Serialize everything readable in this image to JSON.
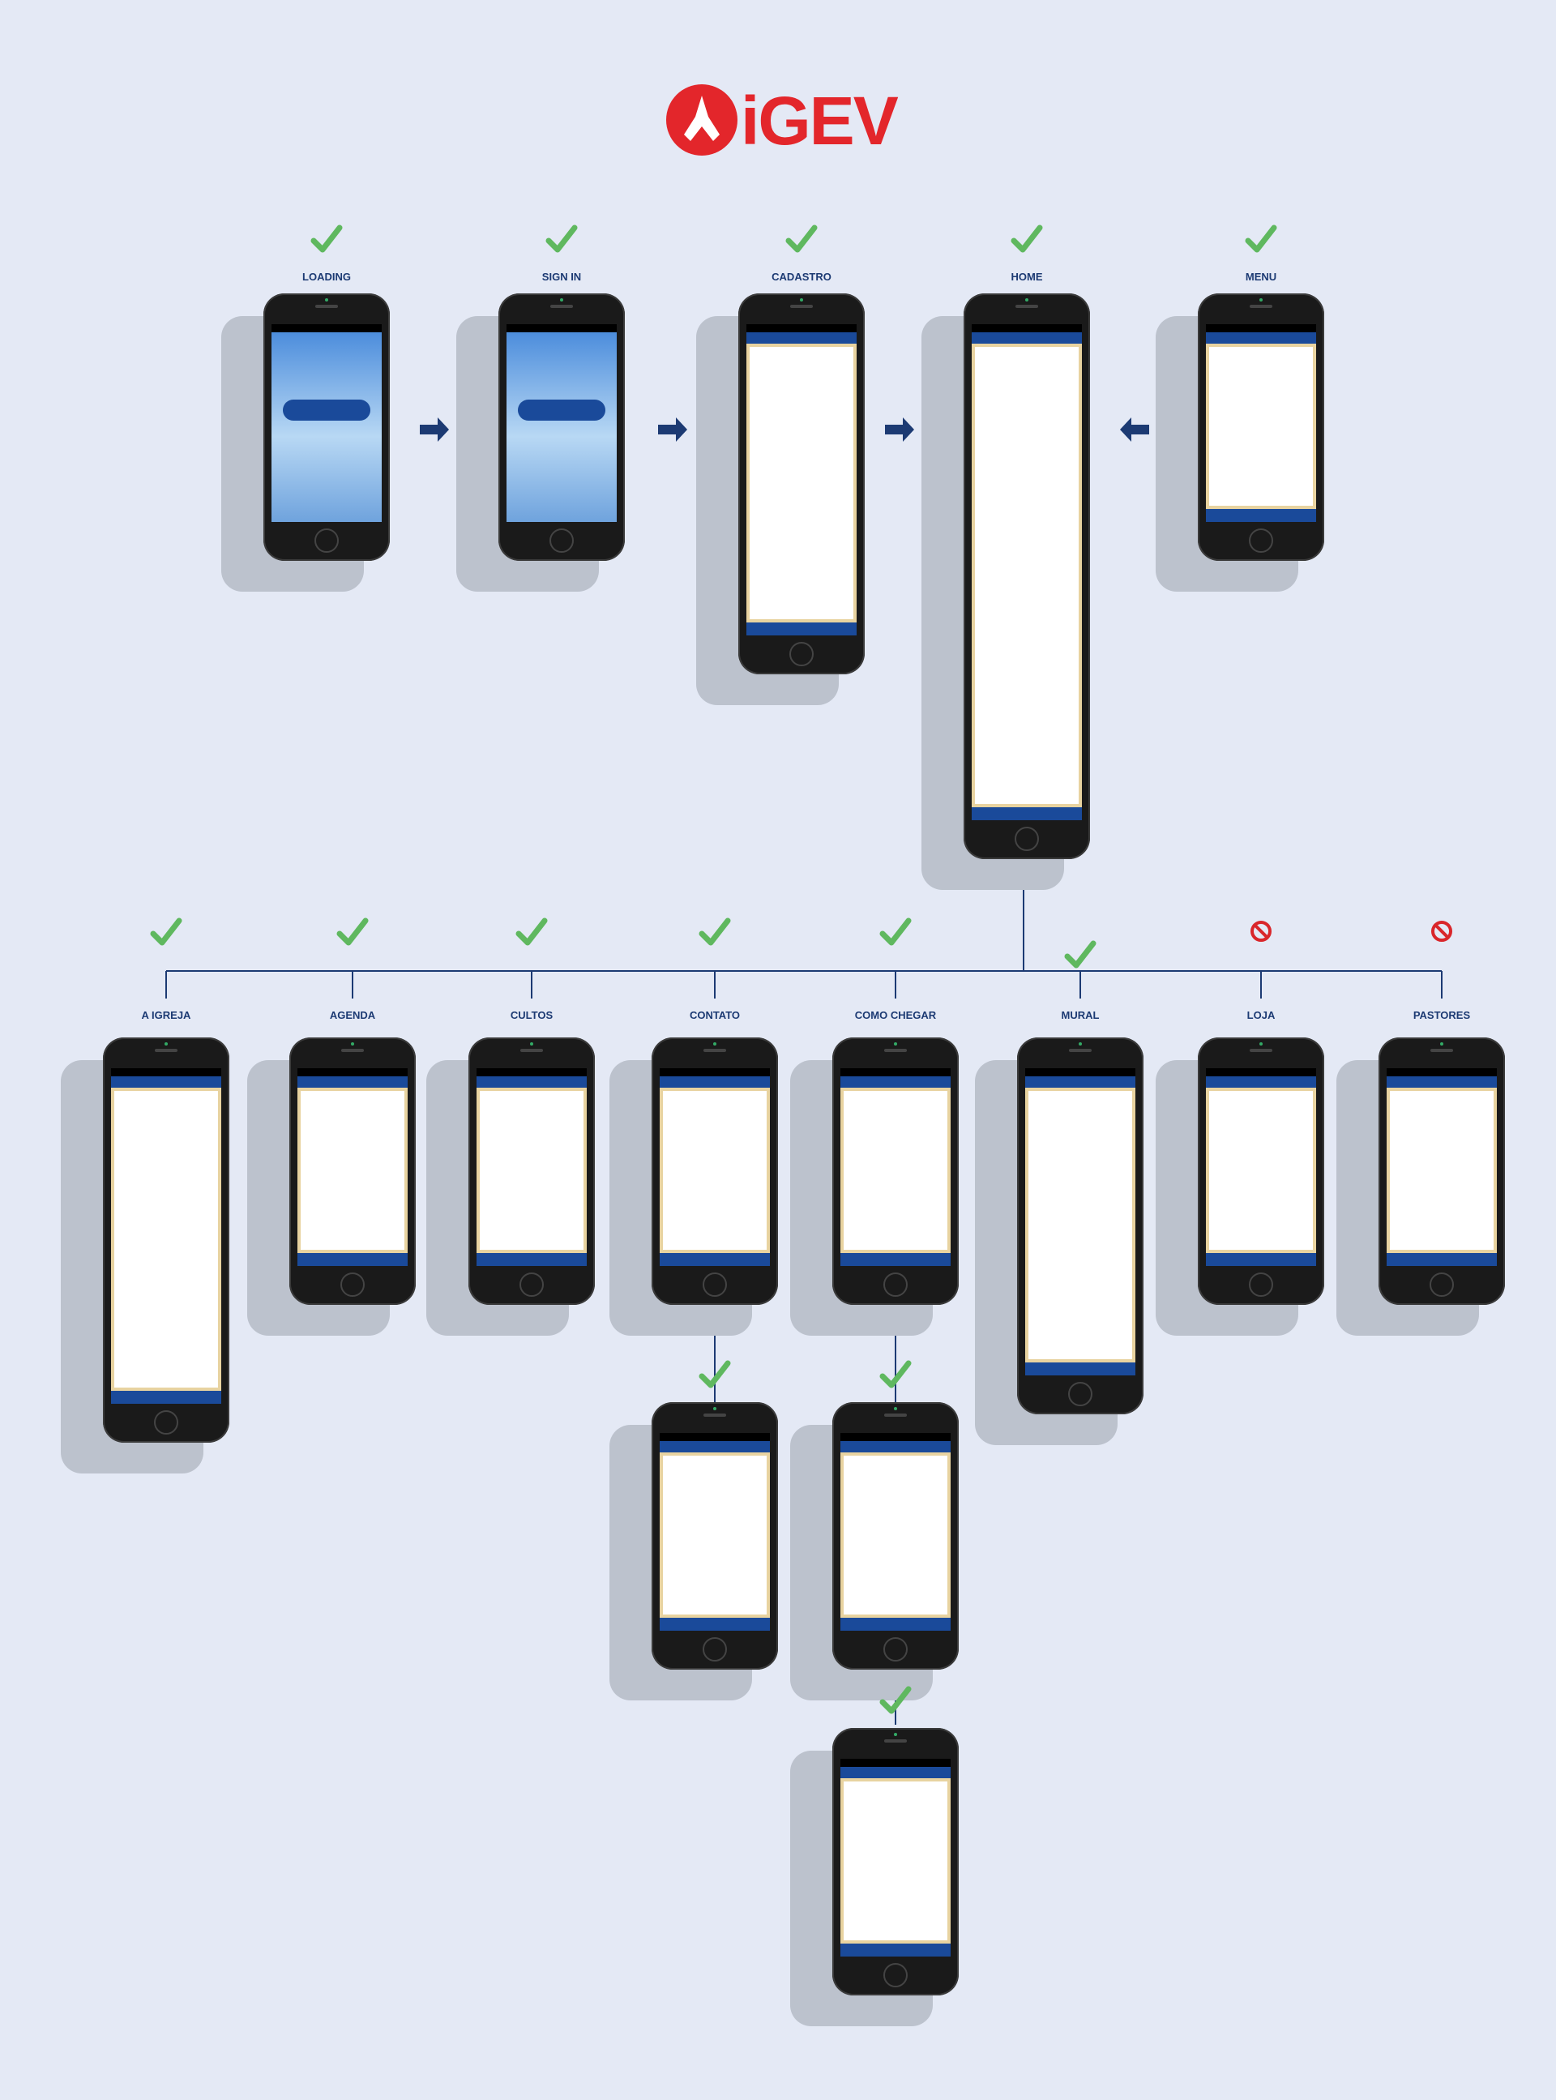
{
  "brand": {
    "logo_text": "iGEV",
    "color": "#e3262b"
  },
  "check_color": "#5fb85f",
  "line_color": "#1c3a73",
  "nodes": [
    {
      "id": "loading",
      "label": "LOADING",
      "status": "done",
      "screen": "Loading"
    },
    {
      "id": "signin",
      "label": "SIGN IN",
      "status": "done",
      "screen": "Sign In"
    },
    {
      "id": "cadastro",
      "label": "CADASTRO",
      "status": "done",
      "screen": "Cadastro"
    },
    {
      "id": "home",
      "label": "HOME",
      "status": "done",
      "screen": "Home"
    },
    {
      "id": "menu",
      "label": "MENU",
      "status": "done",
      "screen": "Menu"
    },
    {
      "id": "aigreja",
      "label": "A IGREJA",
      "status": "done",
      "screen": "A Igreja"
    },
    {
      "id": "agenda",
      "label": "AGENDA",
      "status": "done",
      "screen": "Agenda"
    },
    {
      "id": "cultos",
      "label": "CULTOS",
      "status": "done",
      "screen": "Cultos"
    },
    {
      "id": "contato",
      "label": "CONTATO",
      "status": "done",
      "screen": "Contato"
    },
    {
      "id": "comochegar",
      "label": "COMO CHEGAR",
      "status": "done",
      "screen": "Como Chegar"
    },
    {
      "id": "mural",
      "label": "MURAL",
      "status": "done",
      "screen": "Mural"
    },
    {
      "id": "loja",
      "label": "LOJA",
      "status": "blocked",
      "screen": "Loja"
    },
    {
      "id": "pastores",
      "label": "PASTORES",
      "status": "blocked",
      "screen": "Pastores"
    },
    {
      "id": "contato2",
      "label": "",
      "status": "done",
      "screen": "Contato"
    },
    {
      "id": "comochegar2",
      "label": "",
      "status": "done",
      "screen": "Como Chegar"
    },
    {
      "id": "comochegar3",
      "label": "",
      "status": "done",
      "screen": "Como Chegar"
    }
  ],
  "edges": [
    [
      "loading",
      "signin"
    ],
    [
      "signin",
      "cadastro"
    ],
    [
      "cadastro",
      "home"
    ],
    [
      "menu",
      "home"
    ],
    [
      "home",
      "aigreja"
    ],
    [
      "home",
      "agenda"
    ],
    [
      "home",
      "cultos"
    ],
    [
      "home",
      "contato"
    ],
    [
      "home",
      "comochegar"
    ],
    [
      "home",
      "mural"
    ],
    [
      "home",
      "loja"
    ],
    [
      "home",
      "pastores"
    ],
    [
      "contato",
      "contato2"
    ],
    [
      "comochegar",
      "comochegar2"
    ],
    [
      "comochegar2",
      "comochegar3"
    ]
  ]
}
